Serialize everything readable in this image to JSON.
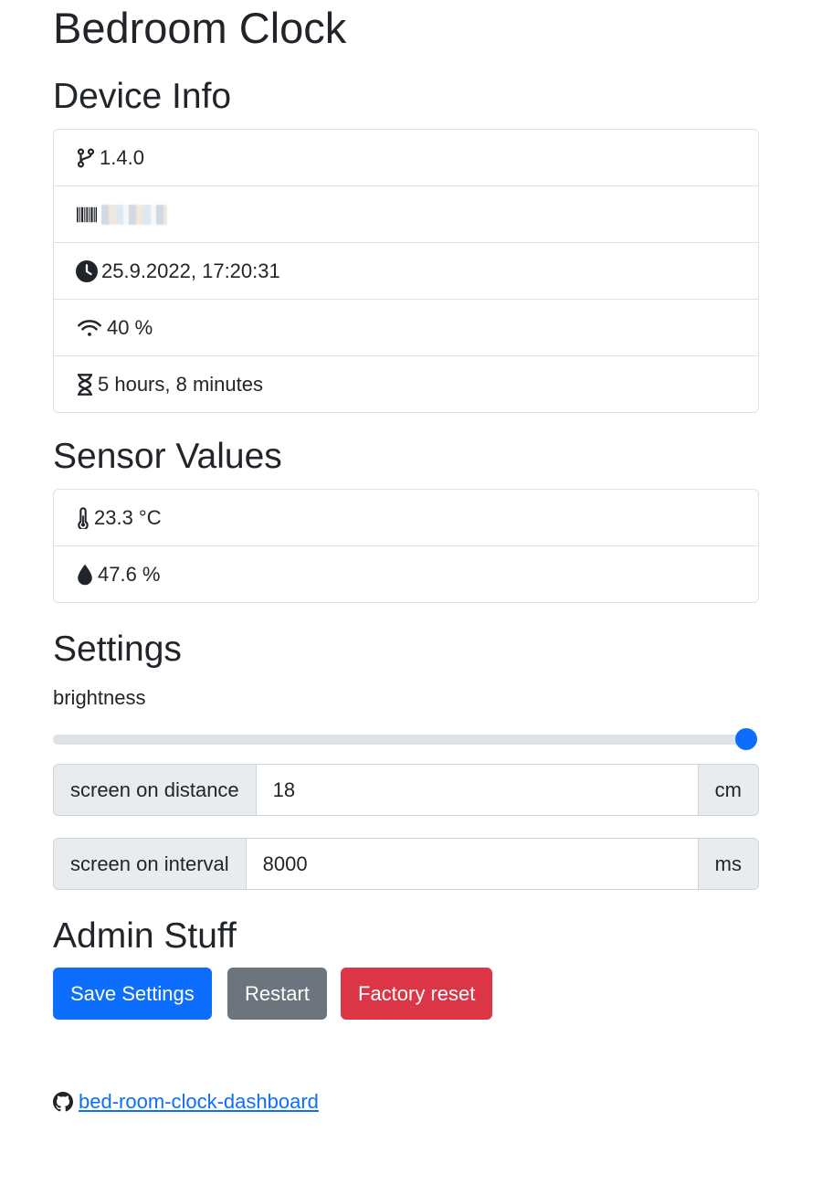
{
  "page": {
    "title": "Bedroom Clock"
  },
  "device_info": {
    "heading": "Device Info",
    "items": [
      {
        "icon": "git-branch-icon",
        "text": "1.4.0"
      },
      {
        "icon": "barcode-icon",
        "text": ""
      },
      {
        "icon": "clock-icon",
        "text": "25.9.2022, 17:20:31"
      },
      {
        "icon": "wifi-icon",
        "text": "40 %"
      },
      {
        "icon": "hourglass-icon",
        "text": "5 hours, 8 minutes"
      }
    ]
  },
  "sensor_values": {
    "heading": "Sensor Values",
    "items": [
      {
        "icon": "thermometer-icon",
        "text": "23.3 °C"
      },
      {
        "icon": "droplet-icon",
        "text": "47.6 %"
      }
    ]
  },
  "settings": {
    "heading": "Settings",
    "brightness": {
      "label": "brightness",
      "value_fraction": 1.0
    },
    "screen_on_distance": {
      "label": "screen on distance",
      "value": "18",
      "unit": "cm"
    },
    "screen_on_interval": {
      "label": "screen on interval",
      "value": "8000",
      "unit": "ms"
    }
  },
  "admin": {
    "heading": "Admin Stuff",
    "save_label": "Save Settings",
    "restart_label": "Restart",
    "factory_reset_label": "Factory reset"
  },
  "footer": {
    "link_text": "bed-room-clock-dashboard",
    "icon": "github-icon"
  },
  "colors": {
    "primary": "#0d6efd",
    "secondary": "#6c757d",
    "danger": "#dc3545",
    "text": "#212529",
    "border": "#dee2e6",
    "input_addon_bg": "#e9ecef"
  }
}
